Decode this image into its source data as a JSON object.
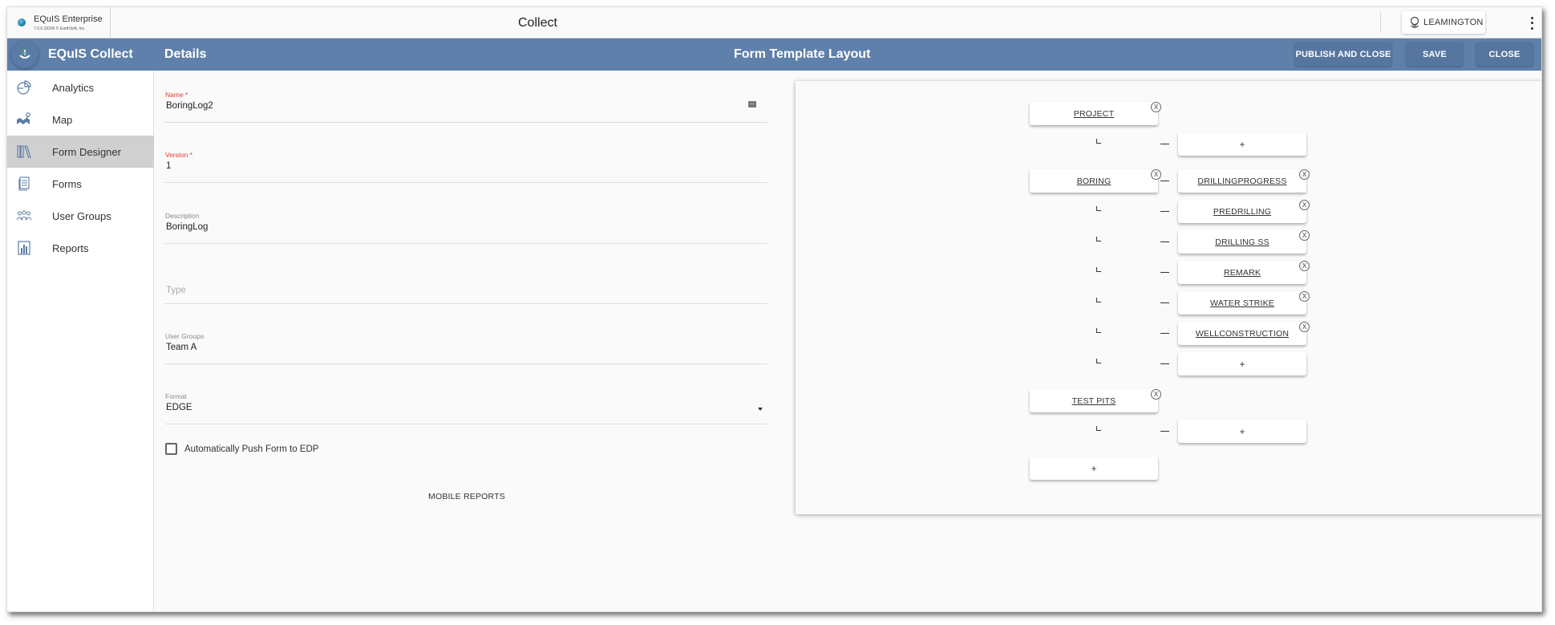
{
  "topbar": {
    "brand_name": "EQuIS Enterprise",
    "brand_version": "7.0.0.18206 © EarthSoft, Inc.",
    "app_title": "Collect",
    "user_label": "LEAMINGTON"
  },
  "header": {
    "app_name": "EQuIS Collect",
    "details_title": "Details",
    "layout_title": "Form Template Layout",
    "buttons": {
      "publish_and_close": "PUBLISH AND CLOSE",
      "save": "SAVE",
      "close": "CLOSE"
    }
  },
  "sidebar": {
    "items": [
      {
        "label": "Analytics",
        "icon": "pie-chart-icon",
        "active": false
      },
      {
        "label": "Map",
        "icon": "map-icon",
        "active": false
      },
      {
        "label": "Form Designer",
        "icon": "library-icon",
        "active": true
      },
      {
        "label": "Forms",
        "icon": "document-icon",
        "active": false
      },
      {
        "label": "User Groups",
        "icon": "users-icon",
        "active": false
      },
      {
        "label": "Reports",
        "icon": "bar-chart-icon",
        "active": false
      }
    ]
  },
  "form": {
    "name": {
      "label": "Name *",
      "value": "BoringLog2",
      "required": true
    },
    "version": {
      "label": "Version *",
      "value": "1",
      "required": true
    },
    "description": {
      "label": "Description",
      "value": "BoringLog"
    },
    "type": {
      "placeholder": "Type",
      "value": ""
    },
    "user_groups": {
      "label": "User Groups",
      "value": "Team A"
    },
    "format": {
      "label": "Format",
      "value": "EDGE"
    },
    "auto_push": {
      "label": "Automatically Push Form to EDP",
      "checked": false
    },
    "mobile_reports_label": "MOBILE REPORTS"
  },
  "layout": {
    "add_label": "+",
    "remove_label": "X",
    "sections": [
      {
        "name": "PROJECT",
        "children": []
      },
      {
        "name": "BORING",
        "children": [
          "DRILLINGPROGRESS",
          "PREDRILLING",
          "DRILLING SS",
          "REMARK",
          "WATER STRIKE",
          "WELLCONSTRUCTION"
        ]
      },
      {
        "name": "TEST PITS",
        "children": []
      }
    ]
  },
  "colors": {
    "header_blue": "#5f80ab",
    "button_blue": "#57769f",
    "required_red": "#e53935",
    "active_nav": "#d0d0d0"
  }
}
